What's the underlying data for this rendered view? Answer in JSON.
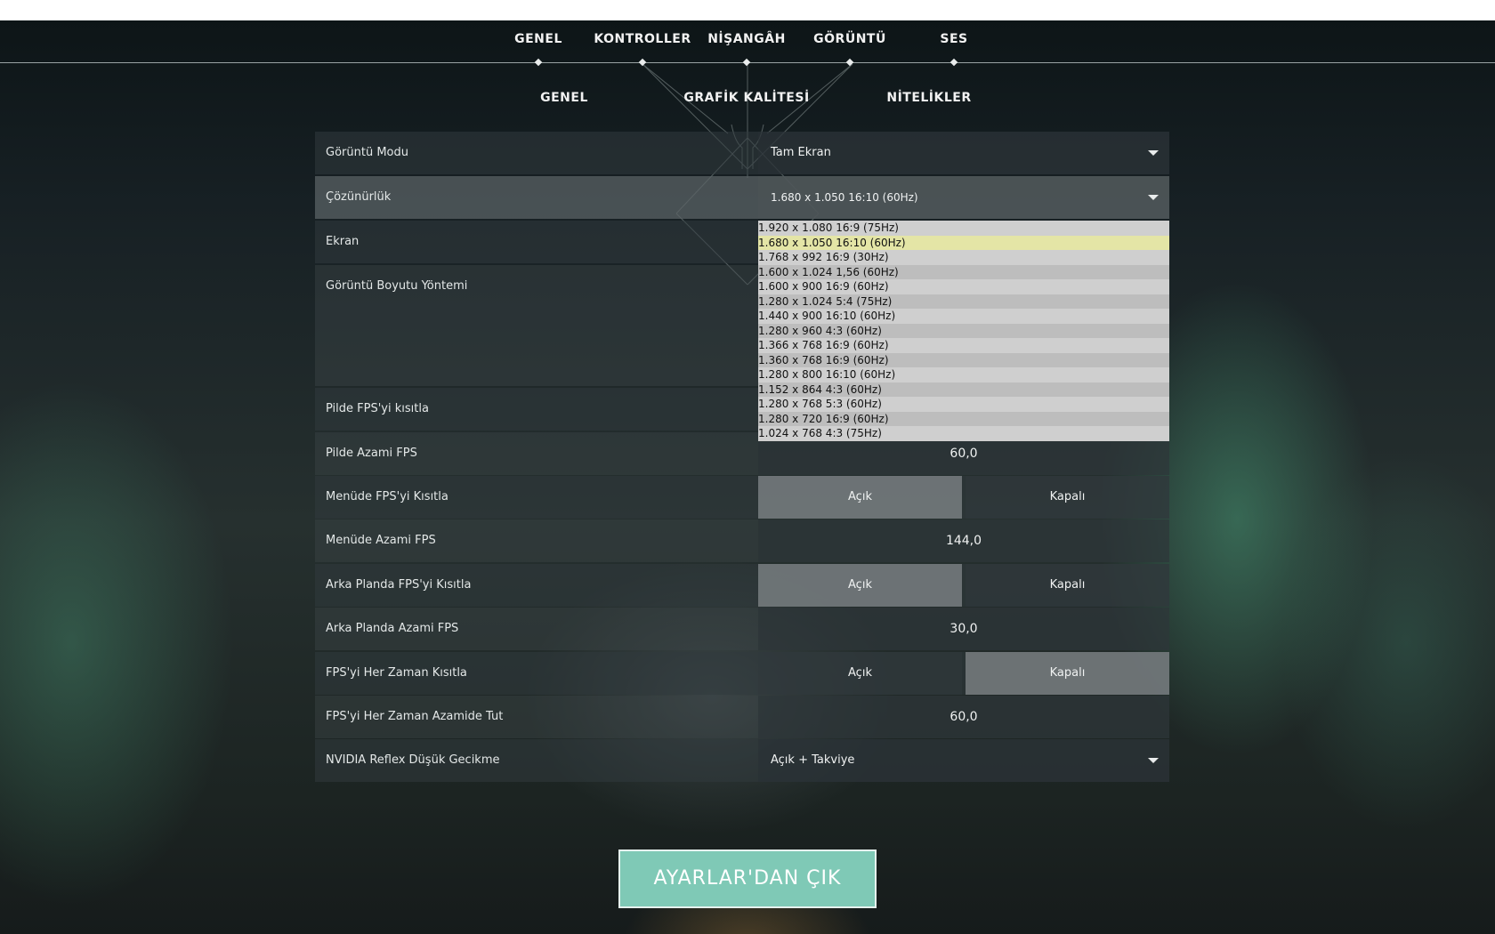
{
  "top_tabs": [
    "GENEL",
    "KONTROLLER",
    "NİŞANGÂH",
    "GÖRÜNTÜ",
    "SES"
  ],
  "sub_tabs": [
    "GENEL",
    "GRAFİK KALİTESİ",
    "NİTELİKLER"
  ],
  "rows": {
    "display_mode": {
      "label": "Görüntü Modu",
      "value": "Tam Ekran"
    },
    "resolution": {
      "label": "Çözünürlük",
      "value": "1.680 x 1.050 16:10 (60Hz)"
    },
    "screen": {
      "label": "Ekran"
    },
    "scaling": {
      "label": "Görüntü Boyutu Yöntemi"
    },
    "limit_fps_battery": {
      "label": "Pilde FPS'yi kısıtla"
    },
    "max_fps_battery": {
      "label": "Pilde Azami FPS",
      "value": "60,0"
    },
    "limit_fps_menu": {
      "label": "Menüde FPS'yi Kısıtla",
      "on": "Açık",
      "off": "Kapalı",
      "selected": "on"
    },
    "max_fps_menu": {
      "label": "Menüde Azami FPS",
      "value": "144,0"
    },
    "limit_fps_background": {
      "label": "Arka Planda FPS'yi Kısıtla",
      "on": "Açık",
      "off": "Kapalı",
      "selected": "on"
    },
    "max_fps_background": {
      "label": "Arka Planda Azami FPS",
      "value": "30,0"
    },
    "limit_fps_always": {
      "label": "FPS'yi Her Zaman Kısıtla",
      "on": "Açık",
      "off": "Kapalı",
      "selected": "off"
    },
    "max_fps_always": {
      "label": "FPS'yi Her Zaman Azamide Tut",
      "value": "60,0"
    },
    "nvidia_reflex": {
      "label": "NVIDIA Reflex Düşük Gecikme",
      "value": "Açık + Takviye"
    }
  },
  "resolution_options": [
    "1.920 x 1.080 16:9 (75Hz)",
    "1.680 x 1.050 16:10 (60Hz)",
    "1.768 x 992 16:9 (30Hz)",
    "1.600 x 1.024 1,56 (60Hz)",
    "1.600 x 900 16:9 (60Hz)",
    "1.280 x 1.024 5:4 (75Hz)",
    "1.440 x 900 16:10 (60Hz)",
    "1.280 x 960 4:3 (60Hz)",
    "1.366 x 768 16:9 (60Hz)",
    "1.360 x 768 16:9 (60Hz)",
    "1.280 x 800 16:10 (60Hz)",
    "1.152 x 864 4:3 (60Hz)",
    "1.280 x 768 5:3 (60Hz)",
    "1.280 x 720 16:9 (60Hz)",
    "1.024 x 768 4:3 (75Hz)"
  ],
  "selected_resolution_index": 1,
  "exit_button": "AYARLAR'DAN ÇIK"
}
